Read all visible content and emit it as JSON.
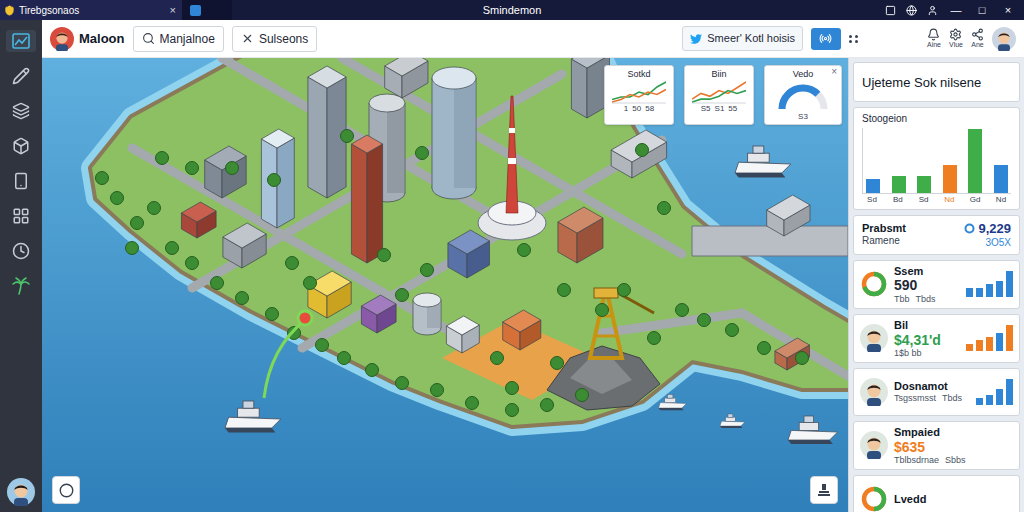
{
  "window": {
    "tab": {
      "label": "Tirebgsonaos",
      "close": "×"
    },
    "title": "Smindemon",
    "controls": [
      "—",
      "□",
      "×"
    ]
  },
  "toolbar": {
    "user": "Maloon",
    "search": {
      "value": "Manjalnoe"
    },
    "filter": {
      "label": "Sulseons"
    },
    "feed": {
      "label": "Smeer' Kotl hoisis"
    },
    "actions": [
      {
        "label": "Aine"
      },
      {
        "label": "Vlue"
      },
      {
        "label": "Ane"
      }
    ]
  },
  "sidebar": {
    "items": [
      {
        "selected": true
      },
      {
        "selected": false
      },
      {
        "selected": false
      },
      {
        "selected": false
      },
      {
        "selected": false
      },
      {
        "selected": false
      },
      {
        "selected": false
      },
      {
        "selected": false
      }
    ]
  },
  "map_cards": [
    {
      "kind": "line",
      "title": "Sotkd",
      "series": [
        {
          "color": "#2e9e4f",
          "values": [
            2,
            3,
            3,
            5,
            4,
            7,
            9
          ]
        },
        {
          "color": "#e8772e",
          "values": [
            1,
            2,
            4,
            3,
            5,
            4,
            6
          ]
        }
      ],
      "ticks": [
        "1",
        "50",
        "58"
      ]
    },
    {
      "kind": "line",
      "title": "Biin",
      "series": [
        {
          "color": "#e8772e",
          "values": [
            2,
            4,
            3,
            5,
            4,
            6,
            8
          ]
        },
        {
          "color": "#2e9e4f",
          "values": [
            1,
            2,
            2,
            3,
            5,
            4,
            5
          ]
        }
      ],
      "ticks": [
        "S5",
        "S1",
        "55"
      ]
    },
    {
      "kind": "gauge",
      "title": "Vedo",
      "level": 0.75,
      "ticks": [
        "S3"
      ],
      "close": "×"
    }
  ],
  "panel": {
    "header": "Ujeteme Sok nilsene",
    "chart": {
      "title": "Stoogeion",
      "bars": [
        {
          "label": "Sd",
          "value": 18,
          "color": "#2f86d6"
        },
        {
          "label": "Bd",
          "value": 22,
          "color": "#3fae49"
        },
        {
          "label": "Sd",
          "value": 22,
          "color": "#3fae49"
        },
        {
          "label": "Nd",
          "value": 36,
          "color": "#ef7d22"
        },
        {
          "label": "Gd",
          "value": 82,
          "color": "#3fae49"
        },
        {
          "label": "Nd",
          "value": 36,
          "color": "#2f86d6"
        }
      ]
    },
    "summary": {
      "title": "Prabsmt",
      "subtitle": "Ramene",
      "value": "9,229",
      "delta": "3O5X"
    },
    "items": [
      {
        "kind": "donut",
        "title": "Ssem",
        "value": "590",
        "value_color": "#1f2937",
        "lines": [
          "Tbb",
          "Tbds"
        ],
        "level": 0.7,
        "bars": [
          {
            "value": 3,
            "color": "#2f86d6"
          },
          {
            "value": 3,
            "color": "#2f86d6"
          },
          {
            "value": 4,
            "color": "#2f86d6"
          },
          {
            "value": 5,
            "color": "#2f86d6"
          },
          {
            "value": 8,
            "color": "#2f86d6"
          }
        ]
      },
      {
        "kind": "person",
        "title": "Bil",
        "value": "$4,31'd",
        "value_color": "#2e9e4f",
        "lines": [
          "1$b bb"
        ],
        "bars": [
          {
            "value": 2,
            "color": "#ef7d22"
          },
          {
            "value": 3,
            "color": "#ef7d22"
          },
          {
            "value": 4,
            "color": "#ef7d22"
          },
          {
            "value": 5,
            "color": "#2f86d6"
          },
          {
            "value": 7,
            "color": "#ef7d22"
          }
        ]
      },
      {
        "kind": "person",
        "title": "Dosnamot",
        "lines": [
          "Tsgssmsst",
          "Tbds"
        ],
        "bars": [
          {
            "value": 2,
            "color": "#2f86d6"
          },
          {
            "value": 3,
            "color": "#2f86d6"
          },
          {
            "value": 5,
            "color": "#2f86d6"
          },
          {
            "value": 8,
            "color": "#2f86d6"
          }
        ]
      },
      {
        "kind": "person",
        "title": "Smpaied",
        "value": "$635",
        "value_color": "#ef7d22",
        "lines": [
          "Tblbsdrnae",
          "Sbbs"
        ]
      },
      {
        "kind": "donut",
        "title": "Lvedd",
        "lines": [],
        "level": 0.5
      }
    ]
  }
}
